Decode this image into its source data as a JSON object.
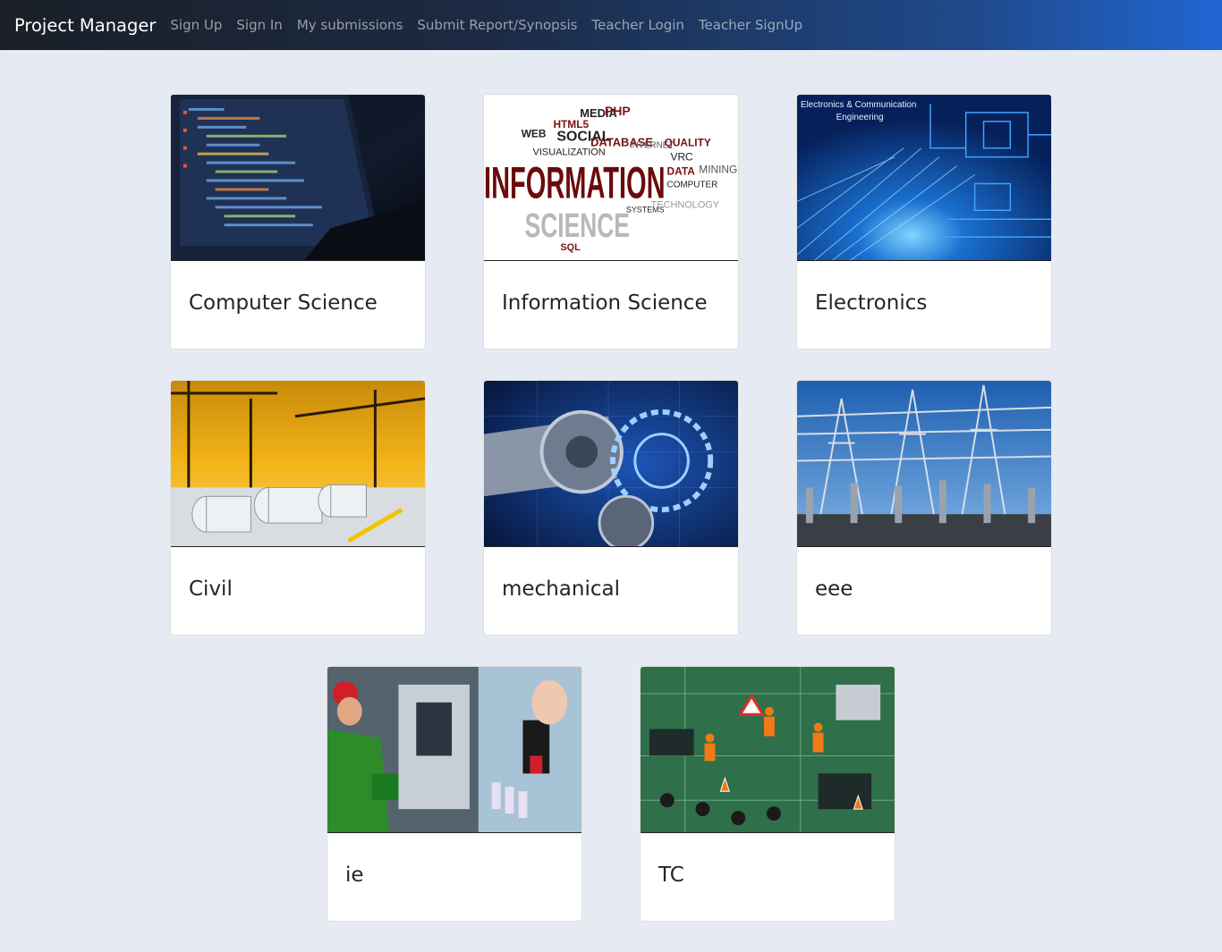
{
  "navbar": {
    "brand": "Project Manager",
    "links": [
      "Sign Up",
      "Sign In",
      "My submissions",
      "Submit Report/Synopsis",
      "Teacher Login",
      "Teacher SignUp"
    ]
  },
  "cards": [
    {
      "title": "Computer Science"
    },
    {
      "title": "Information Science",
      "image_text": {
        "main": "INFORMATION",
        "science": "SCIENCE",
        "words": [
          "MEDIA",
          "PHP",
          "HTML5",
          "WEB",
          "SOCIAL",
          "DATABASE",
          "INTERNET",
          "QUALITY",
          "VISUALIZATION",
          "VRC",
          "DATA",
          "MINING",
          "COMPUTER",
          "SYSTEMS",
          "TECHNOLOGY",
          "SQL"
        ]
      }
    },
    {
      "title": "Electronics",
      "image_text": {
        "line1": "Electronics & Communication",
        "line2": "Engineering"
      }
    },
    {
      "title": "Civil"
    },
    {
      "title": "mechanical"
    },
    {
      "title": "eee"
    },
    {
      "title": "ie"
    },
    {
      "title": "TC"
    }
  ],
  "colors": {
    "page_bg": "#e6ebf3",
    "nav_start": "#1a1f27",
    "nav_end": "#2166d3",
    "card_bg": "#ffffff",
    "title_text": "#212529"
  }
}
